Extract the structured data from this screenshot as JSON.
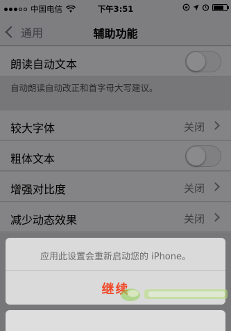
{
  "status_bar": {
    "carrier": "中国电信",
    "time": "下午3:51",
    "battery_level": 0.8
  },
  "nav": {
    "back_label": "通用",
    "title": "辅助功能"
  },
  "cells": {
    "speak_auto_text": {
      "label": "朗读自动文本",
      "toggle_on": false
    },
    "speak_auto_text_note": "自动朗读自动改正和首字母大写建议。",
    "larger_text": {
      "label": "较大字体",
      "value": "关闭"
    },
    "bold_text": {
      "label": "粗体文本",
      "toggle_on": false
    },
    "increase_contrast": {
      "label": "增强对比度",
      "value": "关闭"
    },
    "reduce_motion": {
      "label": "减少动态效果",
      "value": "关闭"
    }
  },
  "action_sheet": {
    "message": "应用此设置会重新启动您的 iPhone。",
    "continue_label": "继续"
  },
  "colors": {
    "accent_destructive": "#f04a2a",
    "dim_overlay": "#7e7e80"
  }
}
